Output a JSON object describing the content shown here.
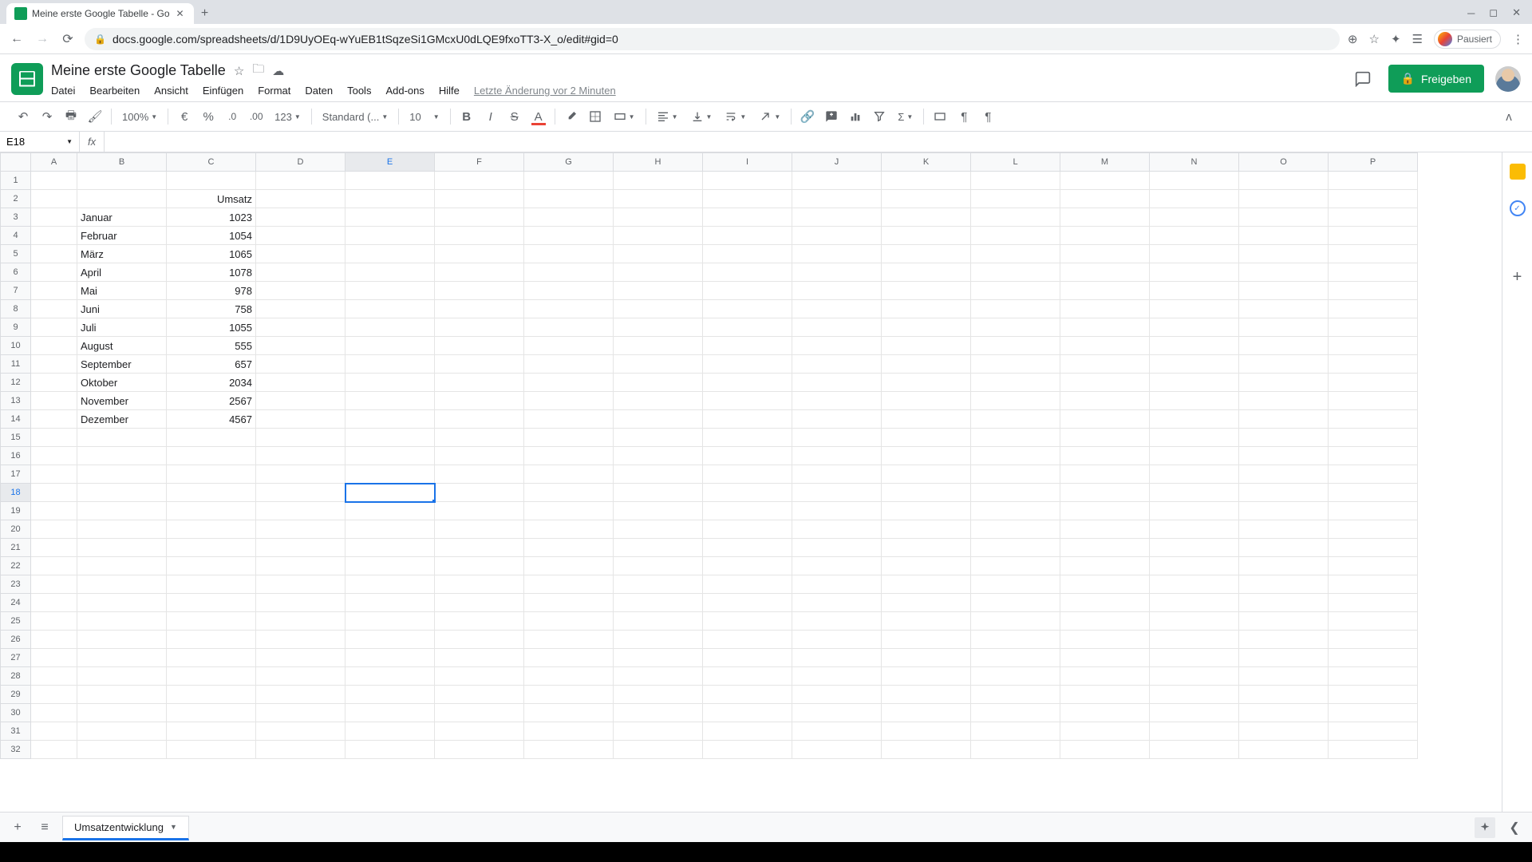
{
  "browser": {
    "tab_title": "Meine erste Google Tabelle - Go",
    "url": "docs.google.com/spreadsheets/d/1D9UyOEq-wYuEB1tSqzeSi1GMcxU0dLQE9fxoTT3-X_o/edit#gid=0",
    "profile_label": "Pausiert"
  },
  "doc": {
    "title": "Meine erste Google Tabelle",
    "status": "Letzte Änderung vor 2 Minuten",
    "share_label": "Freigeben"
  },
  "menu": {
    "file": "Datei",
    "edit": "Bearbeiten",
    "view": "Ansicht",
    "insert": "Einfügen",
    "format": "Format",
    "data": "Daten",
    "tools": "Tools",
    "addons": "Add-ons",
    "help": "Hilfe"
  },
  "toolbar": {
    "zoom": "100%",
    "currency": "€",
    "percent": "%",
    "dec_dec": ".0",
    "dec_inc": ".00",
    "format_menu": "123",
    "font": "Standard (...",
    "font_size": "10"
  },
  "namebox": {
    "cell": "E18"
  },
  "columns": [
    "A",
    "B",
    "C",
    "D",
    "E",
    "F",
    "G",
    "H",
    "I",
    "J",
    "K",
    "L",
    "M",
    "N",
    "O",
    "P"
  ],
  "row_count": 32,
  "active": {
    "col": "E",
    "row": 18
  },
  "cells": {
    "C2": "Umsatz",
    "B3": "Januar",
    "C3": "1023",
    "B4": "Februar",
    "C4": "1054",
    "B5": "März",
    "C5": "1065",
    "B6": "April",
    "C6": "1078",
    "B7": "Mai",
    "C7": "978",
    "B8": "Juni",
    "C8": "758",
    "B9": "Juli",
    "C9": "1055",
    "B10": "August",
    "C10": "555",
    "B11": "September",
    "C11": "657",
    "B12": "Oktober",
    "C12": "2034",
    "B13": "November",
    "C13": "2567",
    "B14": "Dezember",
    "C14": "4567"
  },
  "sheet_tab": "Umsatzentwicklung"
}
